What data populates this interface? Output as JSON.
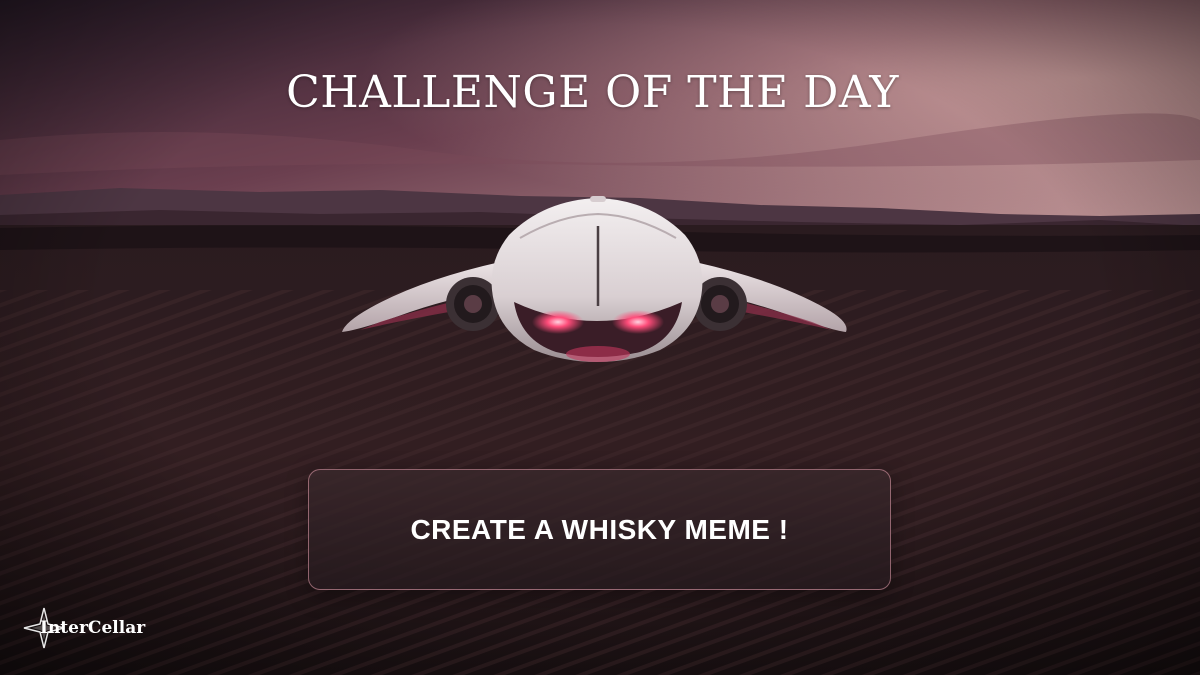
{
  "header": {
    "title": "CHALLENGE OF THE DAY"
  },
  "cta": {
    "label": "CREATE A WHISKY MEME !"
  },
  "brand": {
    "name": "InterCellar"
  },
  "colors": {
    "sky_top": "#3a2533",
    "sky_horizon": "#c5828a",
    "field": "#261719",
    "button_border": "#e6a0af",
    "ship_body": "#e8e2e4",
    "ship_glow": "#ff4d7a"
  },
  "icons": {
    "logo": "diamond-star-icon"
  }
}
